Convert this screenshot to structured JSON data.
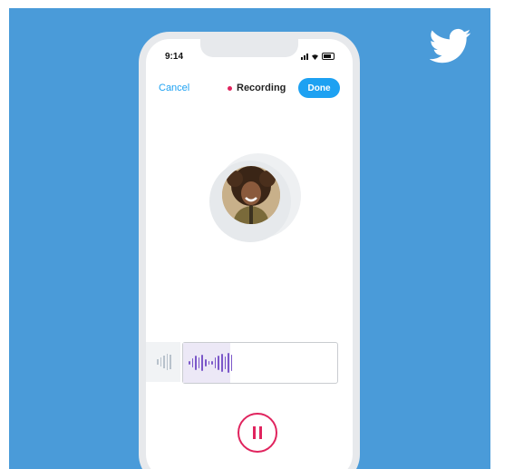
{
  "status_bar": {
    "time": "9:14"
  },
  "header": {
    "cancel_label": "Cancel",
    "title": "Recording",
    "done_label": "Done"
  },
  "colors": {
    "background": "#4a9bd9",
    "accent": "#1da1f2",
    "record": "#e0245e",
    "waveform": "#7b57c9"
  },
  "icons": {
    "brand": "twitter-bird-icon",
    "pause": "pause-icon"
  }
}
